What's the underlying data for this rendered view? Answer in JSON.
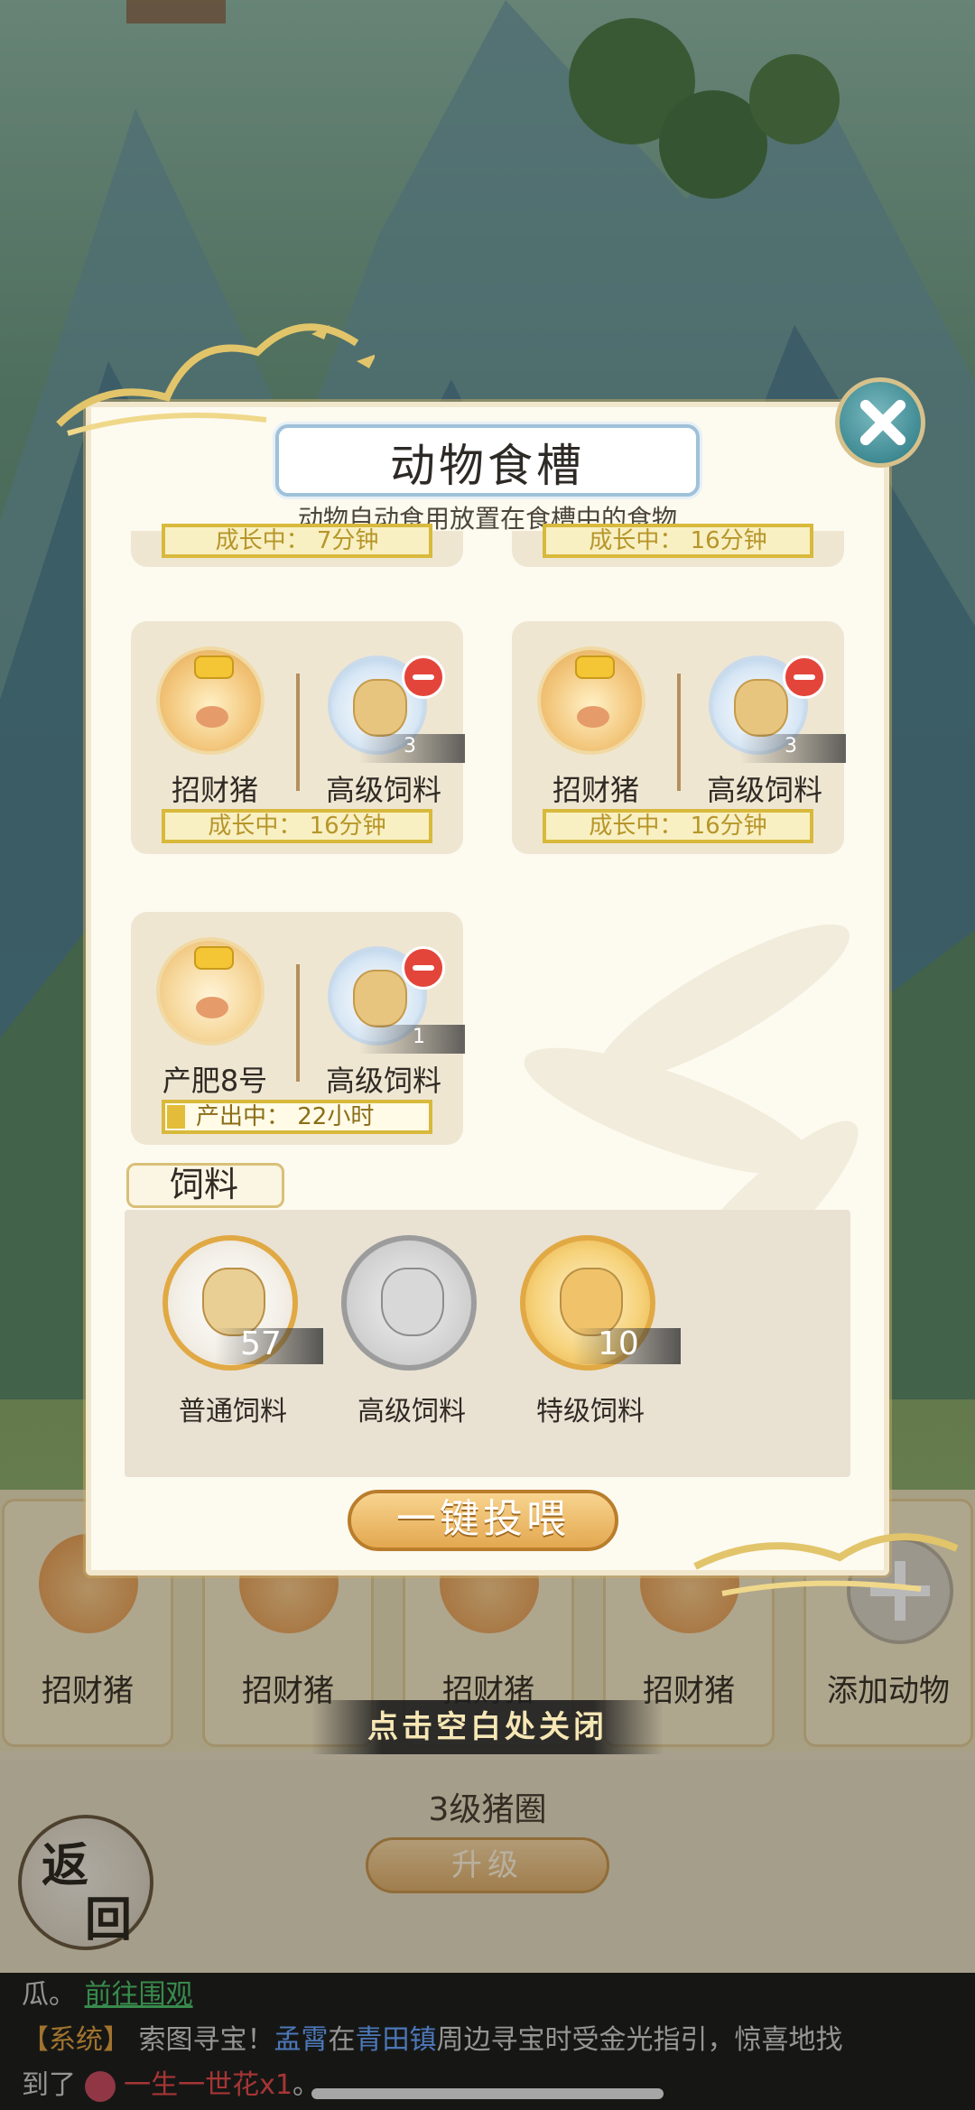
{
  "modal": {
    "title": "动物食槽",
    "subtitle": "动物自动食用放置在食槽中的食物",
    "partial_statuses": [
      "成长中：  7分钟",
      "成长中：  16分钟"
    ],
    "troughs": [
      {
        "animal": "招财猪",
        "feed": "高级饲料",
        "count": "3",
        "status": "成长中：  16分钟"
      },
      {
        "animal": "招财猪",
        "feed": "高级饲料",
        "count": "3",
        "status": "成长中：  16分钟"
      },
      {
        "animal": "产肥8号",
        "feed": "高级饲料",
        "count": "1",
        "status": "产出中：  22小时"
      }
    ],
    "feed_section_label": "饲料",
    "feeds": [
      {
        "name": "普通饲料",
        "count": "57"
      },
      {
        "name": "高级饲料",
        "count": ""
      },
      {
        "name": "特级饲料",
        "count": "10"
      }
    ],
    "feed_all_button": "一键投喂"
  },
  "close_hint": "点击空白处关闭",
  "pen": {
    "slots": [
      "招财猪",
      "招财猪",
      "招财猪",
      "招财猪"
    ],
    "add_label": "添加动物",
    "level": "3级猪圈",
    "upgrade": "升级",
    "back": [
      "返",
      "回"
    ]
  },
  "chat": {
    "line1_prefix": "瓜。",
    "line1_link": "前往围观",
    "line2_tag": "【系统】",
    "line2_text_a": "索图寻宝！",
    "line2_name": "孟霄",
    "line2_text_b": "在",
    "line2_place": "青田镇",
    "line2_text_c": "周边寻宝时受金光指引，惊喜地找",
    "line3_prefix": "到了",
    "line3_item": "一生一世花x1",
    "line3_suffix": "。"
  }
}
